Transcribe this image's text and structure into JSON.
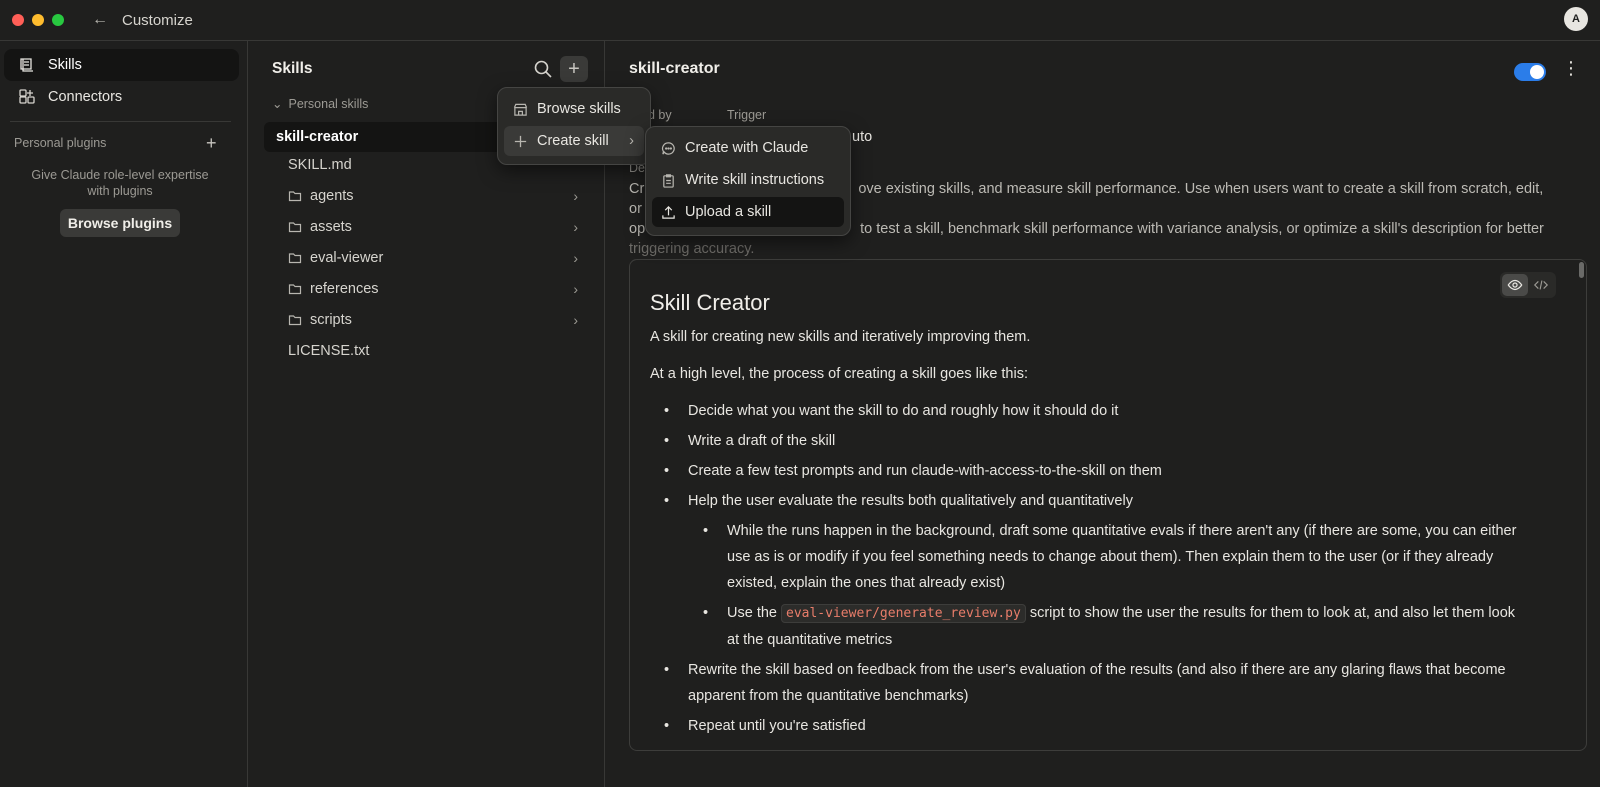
{
  "window": {
    "title": "Customize",
    "avatar_initial": "A"
  },
  "leftnav": {
    "items": [
      {
        "label": "Skills",
        "icon": "skills-icon",
        "active": true
      },
      {
        "label": "Connectors",
        "icon": "connectors-icon",
        "active": false
      }
    ],
    "plugins_section_label": "Personal plugins",
    "plugins_empty_text": "Give Claude role-level expertise with plugins",
    "browse_plugins_label": "Browse plugins"
  },
  "midpanel": {
    "title": "Skills",
    "group_label": "Personal skills",
    "selected_skill": "skill-creator",
    "files": [
      {
        "name": "SKILL.md",
        "type": "file"
      },
      {
        "name": "agents",
        "type": "folder"
      },
      {
        "name": "assets",
        "type": "folder"
      },
      {
        "name": "eval-viewer",
        "type": "folder"
      },
      {
        "name": "references",
        "type": "folder"
      },
      {
        "name": "scripts",
        "type": "folder"
      },
      {
        "name": "LICENSE.txt",
        "type": "file"
      }
    ]
  },
  "menu": {
    "browse_skills": "Browse skills",
    "create_skill": "Create skill",
    "submenu": {
      "create_with_claude": "Create with Claude",
      "write_instructions": "Write skill instructions",
      "upload": "Upload a skill"
    }
  },
  "skill": {
    "title": "skill-creator",
    "enabled": true,
    "meta_label_1": "ed by",
    "meta_label_2": "Trigger",
    "trigger_value_partial": "uto",
    "desc_label_partial": "De",
    "description_line1_a": "Cr",
    "description_line1_b": "ove existing skills, and measure skill performance. Use when users want to create a skill from scratch, edit, or",
    "description_line2_a": "op",
    "description_line2_b": "to test a skill, benchmark skill performance with variance analysis, or optimize a skill's description for better",
    "description_line3": "triggering accuracy."
  },
  "doc": {
    "heading": "Skill Creator",
    "intro": "A skill for creating new skills and iteratively improving them.",
    "lead": "At a high level, the process of creating a skill goes like this:",
    "bullets": [
      "Decide what you want the skill to do and roughly how it should do it",
      "Write a draft of the skill",
      "Create a few test prompts and run claude-with-access-to-the-skill on them",
      "Help the user evaluate the results both qualitatively and quantitatively"
    ],
    "sub_bullet_1_line1": "While the runs happen in the background, draft some quantitative evals if there aren't any (if there are some, you can either",
    "sub_bullet_1_line2": "use as is or modify if you feel something needs to change about them). Then explain them to the user (or if they already",
    "sub_bullet_1_line3": "existed, explain the ones that already exist)",
    "sub_bullet_2_pre": "Use the ",
    "sub_bullet_2_code": "eval-viewer/generate_review.py",
    "sub_bullet_2_post": " script to show the user the results for them to look at, and also let them look",
    "sub_bullet_2_line2": "at the quantitative metrics",
    "bullet_5_line1": "Rewrite the skill based on feedback from the user's evaluation of the results (and also if there are any glaring flaws that become",
    "bullet_5_line2": "apparent from the quantitative benchmarks)",
    "bullet_6": "Repeat until you're satisfied"
  },
  "colors": {
    "accent": "#2b7de9",
    "background": "#1f1f1e",
    "code": "#e87d6a"
  }
}
